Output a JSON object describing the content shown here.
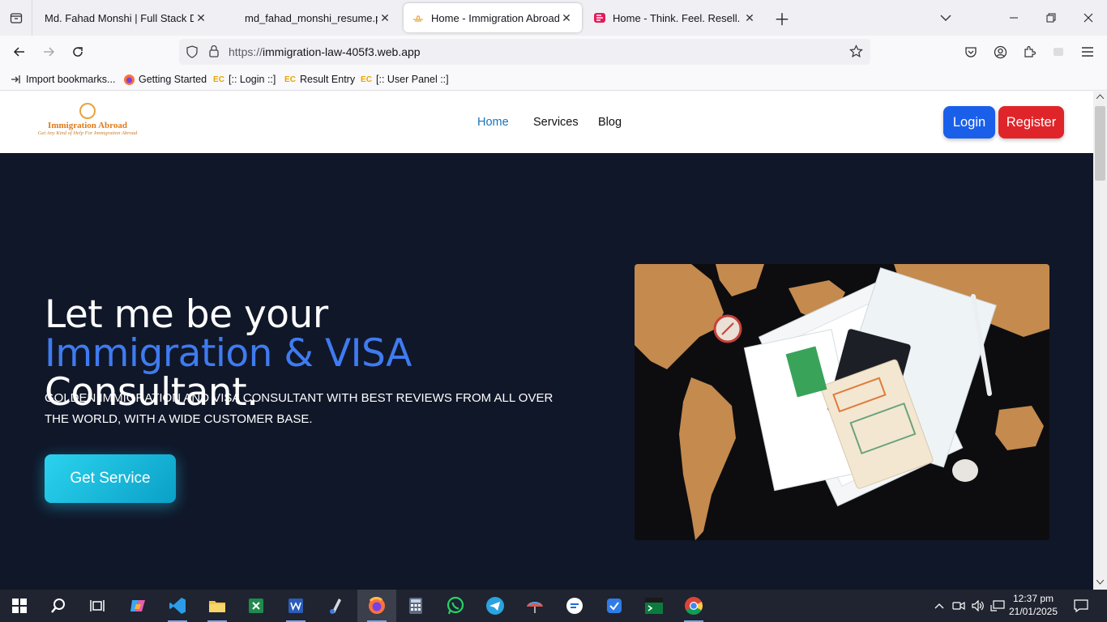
{
  "browser": {
    "tabs": [
      {
        "title": "Md. Fahad Monshi | Full Stack Devel",
        "icon": "none"
      },
      {
        "title": "md_fahad_monshi_resume.pdf",
        "icon": "none"
      },
      {
        "title": "Home - Immigration Abroad",
        "icon": "plane-icon"
      },
      {
        "title": "Home - Think. Feel. Resell.",
        "icon": "resell-logo-icon"
      }
    ],
    "url_protocol": "https://",
    "url_host": "immigration-law-405f3.web.app",
    "bookmarks": [
      "Import bookmarks...",
      "Getting Started",
      "[:: Login ::]",
      "Result Entry",
      "[:: User Panel ::]"
    ]
  },
  "site": {
    "logo": {
      "name": "Immigration Abroad",
      "tagline": "Get Any Kind of Help For Immigration Abroad"
    },
    "nav": [
      "Home",
      "Services",
      "Blog"
    ],
    "login_label": "Login",
    "register_label": "Register",
    "hero": {
      "title_part1": "Let me be your ",
      "title_highlight": "Immigration & VISA",
      "title_part2": " Consultant.",
      "subtitle": "GOLDEN IMMIGRATION AND VISA CONSULTANT WITH BEST REVIEWS FROM ALL OVER THE WORLD, WITH A WIDE CUSTOMER BASE.",
      "cta_label": "Get Service"
    }
  },
  "taskbar": {
    "time": "12:37 pm",
    "date": "21/01/2025"
  },
  "colors": {
    "hero_bg": "#101729",
    "highlight": "#3f7bf0",
    "login": "#1a5fea",
    "register": "#e0252a",
    "cta": "#17bde0"
  }
}
